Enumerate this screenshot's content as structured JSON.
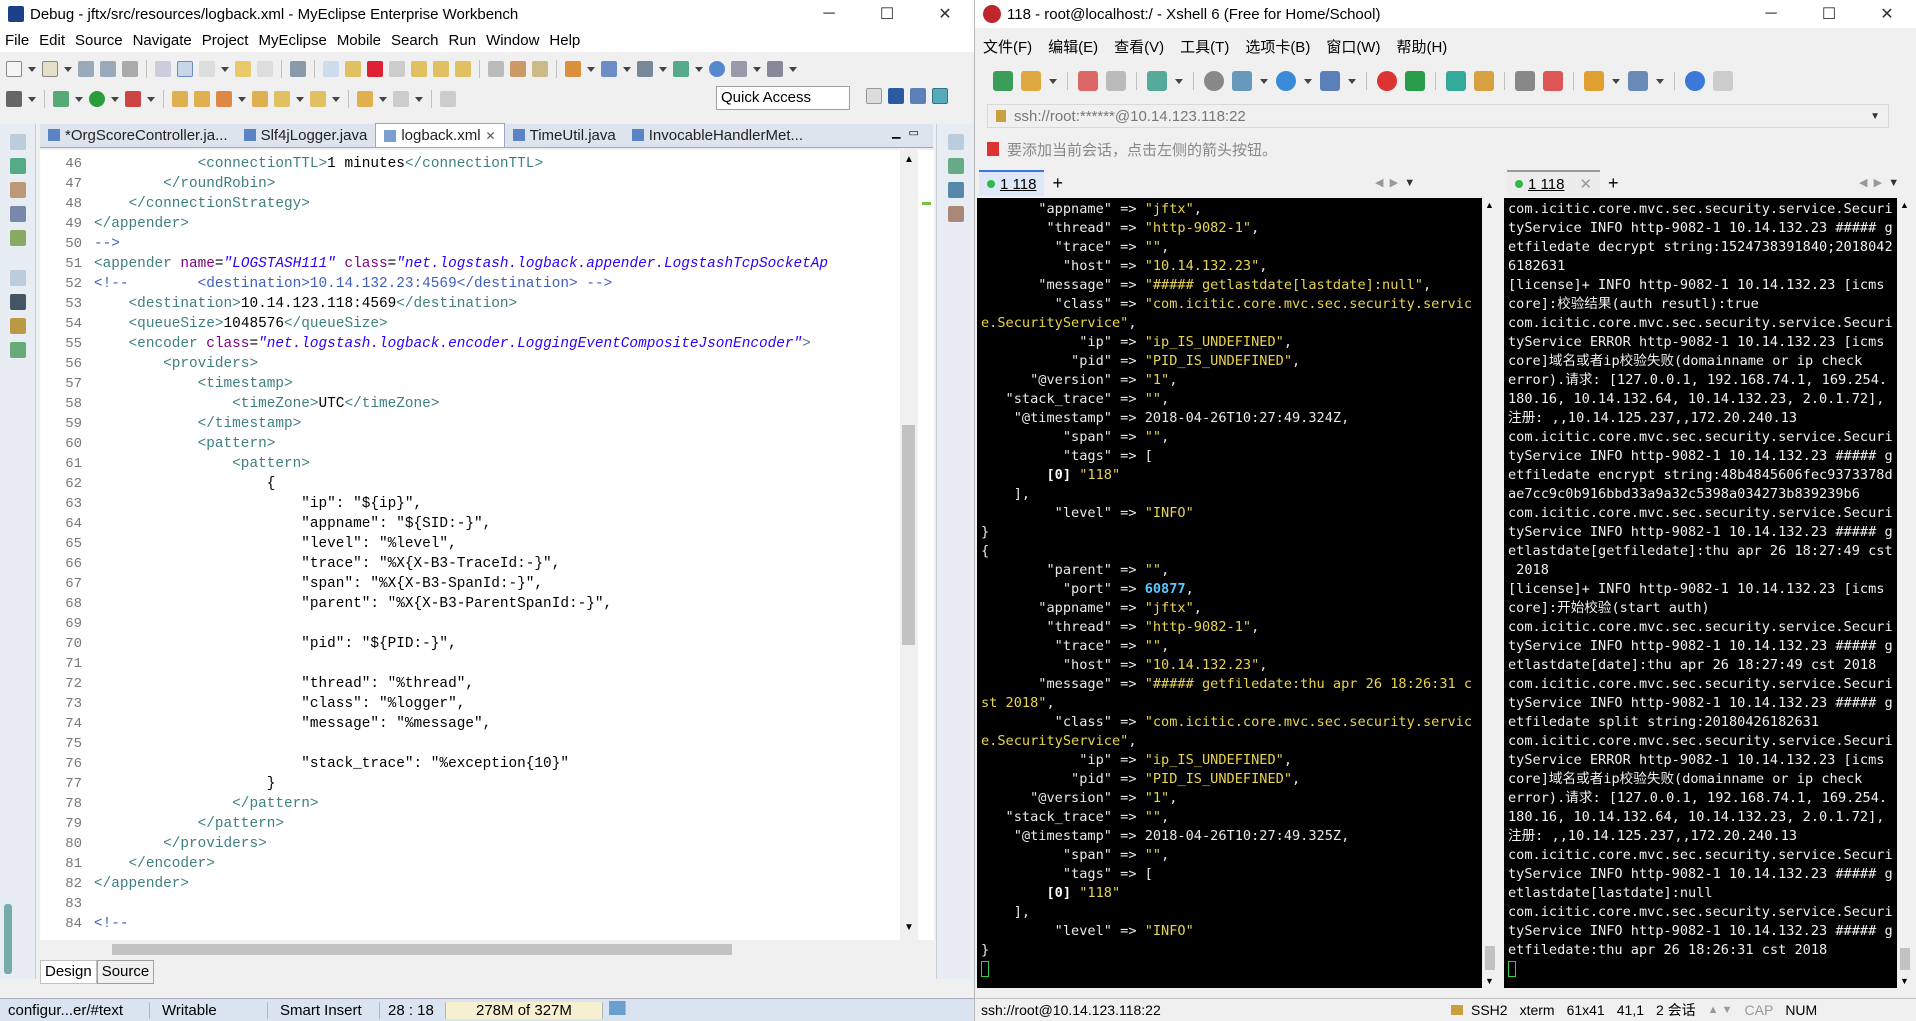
{
  "eclipse": {
    "title": "Debug - jftx/src/resources/logback.xml - MyEclipse Enterprise Workbench",
    "menu": [
      "File",
      "Edit",
      "Source",
      "Navigate",
      "Project",
      "MyEclipse",
      "Mobile",
      "Search",
      "Run",
      "Window",
      "Help"
    ],
    "quick_access_placeholder": "Quick Access",
    "tabs": [
      {
        "label": "*OrgScoreController.ja...",
        "active": false
      },
      {
        "label": "Slf4jLogger.java",
        "active": false
      },
      {
        "label": "logback.xml",
        "active": true
      },
      {
        "label": "TimeUtil.java",
        "active": false
      },
      {
        "label": "InvocableHandlerMet...",
        "active": false
      }
    ],
    "lines": [
      {
        "n": "46",
        "code": [
          [
            "t",
            "            <connectionTTL>"
          ],
          [
            "tx",
            "1 minutes"
          ],
          [
            "t",
            "</connectionTTL>"
          ]
        ]
      },
      {
        "n": "47",
        "code": [
          [
            "t",
            "        </roundRobin>"
          ]
        ]
      },
      {
        "n": "48",
        "code": [
          [
            "t",
            "    </connectionStrategy>"
          ]
        ]
      },
      {
        "n": "49",
        "code": [
          [
            "t",
            "</appender>"
          ]
        ]
      },
      {
        "n": "50",
        "code": [
          [
            "c",
            "-->"
          ]
        ]
      },
      {
        "n": "51",
        "code": [
          [
            "t",
            "<appender "
          ],
          [
            "a",
            "name"
          ],
          [
            "tx",
            "="
          ],
          [
            "v",
            "\"LOGSTASH111\""
          ],
          [
            "tx",
            " "
          ],
          [
            "a",
            "class"
          ],
          [
            "tx",
            "="
          ],
          [
            "v",
            "\"net.logstash.logback.appender.LogstashTcpSocketAp"
          ]
        ]
      },
      {
        "n": "52",
        "code": [
          [
            "c",
            "<!--        <destination>10.14.132.23:4569</destination> -->"
          ]
        ]
      },
      {
        "n": "53",
        "code": [
          [
            "t",
            "    <destination>"
          ],
          [
            "tx",
            "10.14.123.118:4569"
          ],
          [
            "t",
            "</destination>"
          ]
        ]
      },
      {
        "n": "54",
        "code": [
          [
            "t",
            "    <queueSize>"
          ],
          [
            "tx",
            "1048576"
          ],
          [
            "t",
            "</queueSize>"
          ]
        ]
      },
      {
        "n": "55",
        "code": [
          [
            "t",
            "    <encoder "
          ],
          [
            "a",
            "class"
          ],
          [
            "tx",
            "="
          ],
          [
            "v",
            "\"net.logstash.logback.encoder.LoggingEventCompositeJsonEncoder\""
          ],
          [
            "t",
            ">"
          ]
        ]
      },
      {
        "n": "56",
        "code": [
          [
            "t",
            "        <providers>"
          ]
        ]
      },
      {
        "n": "57",
        "code": [
          [
            "t",
            "            <timestamp>"
          ]
        ]
      },
      {
        "n": "58",
        "code": [
          [
            "t",
            "                <timeZone>"
          ],
          [
            "tx",
            "UTC"
          ],
          [
            "t",
            "</timeZone>"
          ]
        ]
      },
      {
        "n": "59",
        "code": [
          [
            "t",
            "            </timestamp>"
          ]
        ]
      },
      {
        "n": "60",
        "code": [
          [
            "t",
            "            <pattern>"
          ]
        ]
      },
      {
        "n": "61",
        "code": [
          [
            "t",
            "                <pattern>"
          ]
        ]
      },
      {
        "n": "62",
        "code": [
          [
            "tx",
            "                    {"
          ]
        ]
      },
      {
        "n": "63",
        "code": [
          [
            "tx",
            "                        \"ip\": \"${ip}\","
          ]
        ]
      },
      {
        "n": "64",
        "code": [
          [
            "tx",
            "                        \"appname\": \"${SID:-}\","
          ]
        ]
      },
      {
        "n": "65",
        "code": [
          [
            "tx",
            "                        \"level\": \"%level\","
          ]
        ]
      },
      {
        "n": "66",
        "code": [
          [
            "tx",
            "                        \"trace\": \"%X{X-B3-TraceId:-}\","
          ]
        ]
      },
      {
        "n": "67",
        "code": [
          [
            "tx",
            "                        \"span\": \"%X{X-B3-SpanId:-}\","
          ]
        ]
      },
      {
        "n": "68",
        "code": [
          [
            "tx",
            "                        \"parent\": \"%X{X-B3-ParentSpanId:-}\","
          ]
        ]
      },
      {
        "n": "69",
        "code": [
          [
            "tx",
            ""
          ]
        ]
      },
      {
        "n": "70",
        "code": [
          [
            "tx",
            "                        \"pid\": \"${PID:-}\","
          ]
        ]
      },
      {
        "n": "71",
        "code": [
          [
            "tx",
            ""
          ]
        ]
      },
      {
        "n": "72",
        "code": [
          [
            "tx",
            "                        \"thread\": \"%thread\","
          ]
        ]
      },
      {
        "n": "73",
        "code": [
          [
            "tx",
            "                        \"class\": \"%logger\","
          ]
        ]
      },
      {
        "n": "74",
        "code": [
          [
            "tx",
            "                        \"message\": \"%message\","
          ]
        ]
      },
      {
        "n": "75",
        "code": [
          [
            "tx",
            ""
          ]
        ]
      },
      {
        "n": "76",
        "code": [
          [
            "tx",
            "                        \"stack_trace\": \"%exception{10}\""
          ]
        ]
      },
      {
        "n": "77",
        "code": [
          [
            "tx",
            "                    }"
          ]
        ]
      },
      {
        "n": "78",
        "code": [
          [
            "t",
            "                </pattern>"
          ]
        ]
      },
      {
        "n": "79",
        "code": [
          [
            "t",
            "            </pattern>"
          ]
        ]
      },
      {
        "n": "80",
        "code": [
          [
            "t",
            "        </providers>"
          ]
        ]
      },
      {
        "n": "81",
        "code": [
          [
            "t",
            "    </encoder>"
          ]
        ]
      },
      {
        "n": "82",
        "code": [
          [
            "t",
            "</appender>"
          ]
        ]
      },
      {
        "n": "83",
        "code": [
          [
            "tx",
            ""
          ]
        ]
      },
      {
        "n": "84",
        "code": [
          [
            "c",
            "<!--"
          ]
        ]
      }
    ],
    "bottom_tabs": [
      "Design",
      "Source"
    ],
    "status": {
      "path": "configur...er/#text",
      "mode": "Writable",
      "insert": "Smart Insert",
      "position": "28 : 18",
      "memory": "278M of 327M"
    }
  },
  "xshell": {
    "title": "118 - root@localhost:/ - Xshell 6 (Free for Home/School)",
    "menu": [
      "文件(F)",
      "编辑(E)",
      "查看(V)",
      "工具(T)",
      "选项卡(B)",
      "窗口(W)",
      "帮助(H)"
    ],
    "address": "ssh://root:******@10.14.123.118:22",
    "hint": "要添加当前会话，点击左侧的箭头按钮。",
    "tab_left": "1 118",
    "tab_right": "1 118",
    "left_terminal": [
      [
        [
          "k",
          "       \"appname\" => "
        ],
        [
          "s",
          "\"jftx\""
        ],
        [
          "k",
          ","
        ]
      ],
      [
        [
          "k",
          "        \"thread\" => "
        ],
        [
          "s",
          "\"http-9082-1\""
        ],
        [
          "k",
          ","
        ]
      ],
      [
        [
          "k",
          "         \"trace\" => "
        ],
        [
          "s",
          "\"\""
        ],
        [
          "k",
          ","
        ]
      ],
      [
        [
          "k",
          "          \"host\" => "
        ],
        [
          "s",
          "\"10.14.132.23\""
        ],
        [
          "k",
          ","
        ]
      ],
      [
        [
          "k",
          "       \"message\" => "
        ],
        [
          "s",
          "\"##### getlastdate[lastdate]:null\""
        ],
        [
          "k",
          ","
        ]
      ],
      [
        [
          "k",
          "         \"class\" => "
        ],
        [
          "s",
          "\"com.icitic.core.mvc.sec.security.servic"
        ]
      ],
      [
        [
          "s",
          "e.SecurityService\""
        ],
        [
          "k",
          ","
        ]
      ],
      [
        [
          "k",
          "            \"ip\" => "
        ],
        [
          "s",
          "\"ip_IS_UNDEFINED\""
        ],
        [
          "k",
          ","
        ]
      ],
      [
        [
          "k",
          "           \"pid\" => "
        ],
        [
          "s",
          "\"PID_IS_UNDEFINED\""
        ],
        [
          "k",
          ","
        ]
      ],
      [
        [
          "k",
          "      \"@version\" => "
        ],
        [
          "s",
          "\"1\""
        ],
        [
          "k",
          ","
        ]
      ],
      [
        [
          "k",
          "   \"stack_trace\" => "
        ],
        [
          "s",
          "\"\""
        ],
        [
          "k",
          ","
        ]
      ],
      [
        [
          "k",
          "    \"@timestamp\" => "
        ],
        [
          "k",
          "2018-04-26T10:27:49.324Z,"
        ]
      ],
      [
        [
          "k",
          "          \"span\" => "
        ],
        [
          "s",
          "\"\""
        ],
        [
          "k",
          ","
        ]
      ],
      [
        [
          "k",
          "          \"tags\" => ["
        ]
      ],
      [
        [
          "w",
          "        [0] "
        ],
        [
          "s",
          "\"118\""
        ]
      ],
      [
        [
          "k",
          "    ],"
        ]
      ],
      [
        [
          "k",
          "         \"level\" => "
        ],
        [
          "s",
          "\"INFO\""
        ]
      ],
      [
        [
          "k",
          "}"
        ]
      ],
      [
        [
          "k",
          "{"
        ]
      ],
      [
        [
          "k",
          "        \"parent\" => "
        ],
        [
          "s",
          "\"\""
        ],
        [
          "k",
          ","
        ]
      ],
      [
        [
          "k",
          "          \"port\" => "
        ],
        [
          "n",
          "60877"
        ],
        [
          "k",
          ","
        ]
      ],
      [
        [
          "k",
          "       \"appname\" => "
        ],
        [
          "s",
          "\"jftx\""
        ],
        [
          "k",
          ","
        ]
      ],
      [
        [
          "k",
          "        \"thread\" => "
        ],
        [
          "s",
          "\"http-9082-1\""
        ],
        [
          "k",
          ","
        ]
      ],
      [
        [
          "k",
          "         \"trace\" => "
        ],
        [
          "s",
          "\"\""
        ],
        [
          "k",
          ","
        ]
      ],
      [
        [
          "k",
          "          \"host\" => "
        ],
        [
          "s",
          "\"10.14.132.23\""
        ],
        [
          "k",
          ","
        ]
      ],
      [
        [
          "k",
          "       \"message\" => "
        ],
        [
          "s",
          "\"##### getfiledate:thu apr 26 18:26:31 c"
        ]
      ],
      [
        [
          "s",
          "st 2018\""
        ],
        [
          "k",
          ","
        ]
      ],
      [
        [
          "k",
          "         \"class\" => "
        ],
        [
          "s",
          "\"com.icitic.core.mvc.sec.security.servic"
        ]
      ],
      [
        [
          "s",
          "e.SecurityService\""
        ],
        [
          "k",
          ","
        ]
      ],
      [
        [
          "k",
          "            \"ip\" => "
        ],
        [
          "s",
          "\"ip_IS_UNDEFINED\""
        ],
        [
          "k",
          ","
        ]
      ],
      [
        [
          "k",
          "           \"pid\" => "
        ],
        [
          "s",
          "\"PID_IS_UNDEFINED\""
        ],
        [
          "k",
          ","
        ]
      ],
      [
        [
          "k",
          "      \"@version\" => "
        ],
        [
          "s",
          "\"1\""
        ],
        [
          "k",
          ","
        ]
      ],
      [
        [
          "k",
          "   \"stack_trace\" => "
        ],
        [
          "s",
          "\"\""
        ],
        [
          "k",
          ","
        ]
      ],
      [
        [
          "k",
          "    \"@timestamp\" => "
        ],
        [
          "k",
          "2018-04-26T10:27:49.325Z,"
        ]
      ],
      [
        [
          "k",
          "          \"span\" => "
        ],
        [
          "s",
          "\"\""
        ],
        [
          "k",
          ","
        ]
      ],
      [
        [
          "k",
          "          \"tags\" => ["
        ]
      ],
      [
        [
          "w",
          "        [0] "
        ],
        [
          "s",
          "\"118\""
        ]
      ],
      [
        [
          "k",
          "    ],"
        ]
      ],
      [
        [
          "k",
          "         \"level\" => "
        ],
        [
          "s",
          "\"INFO\""
        ]
      ],
      [
        [
          "k",
          "}"
        ]
      ]
    ],
    "right_terminal": [
      "com.icitic.core.mvc.sec.security.service.Securi",
      "tyService INFO http-9082-1 10.14.132.23 ##### g",
      "etfiledate decrypt string:1524738391840;2018042",
      "6182631",
      "[license]+ INFO http-9082-1 10.14.132.23 [icms",
      "core]:校验结果(auth resutl):true",
      "com.icitic.core.mvc.sec.security.service.Securi",
      "tyService ERROR http-9082-1 10.14.132.23 [icms",
      "core]域名或者ip校验失败(domainname or ip check",
      "error).请求: [127.0.0.1, 192.168.74.1, 169.254.",
      "180.16, 10.14.132.64, 10.14.132.23, 2.0.1.72],",
      "注册: ,,10.14.125.237,,172.20.240.13",
      "com.icitic.core.mvc.sec.security.service.Securi",
      "tyService INFO http-9082-1 10.14.132.23 ##### g",
      "etfiledate encrypt string:48b4845606fec9373378d",
      "ae7cc9c0b916bbd33a9a32c5398a034273b839239b6",
      "com.icitic.core.mvc.sec.security.service.Securi",
      "tyService INFO http-9082-1 10.14.132.23 ##### g",
      "etlastdate[getfiledate]:thu apr 26 18:27:49 cst",
      " 2018",
      "[license]+ INFO http-9082-1 10.14.132.23 [icms",
      "core]:开始校验(start auth)",
      "com.icitic.core.mvc.sec.security.service.Securi",
      "tyService INFO http-9082-1 10.14.132.23 ##### g",
      "etlastdate[date]:thu apr 26 18:27:49 cst 2018",
      "com.icitic.core.mvc.sec.security.service.Securi",
      "tyService INFO http-9082-1 10.14.132.23 ##### g",
      "etfiledate split string:20180426182631",
      "com.icitic.core.mvc.sec.security.service.Securi",
      "tyService ERROR http-9082-1 10.14.132.23 [icms",
      "core]域名或者ip校验失败(domainname or ip check",
      "error).请求: [127.0.0.1, 192.168.74.1, 169.254.",
      "180.16, 10.14.132.64, 10.14.132.23, 2.0.1.72],",
      "注册: ,,10.14.125.237,,172.20.240.13",
      "com.icitic.core.mvc.sec.security.service.Securi",
      "tyService INFO http-9082-1 10.14.132.23 ##### g",
      "etlastdate[lastdate]:null",
      "com.icitic.core.mvc.sec.security.service.Securi",
      "tyService INFO http-9082-1 10.14.132.23 ##### g",
      "etfiledate:thu apr 26 18:26:31 cst 2018"
    ],
    "status": {
      "connection": "ssh://root@10.14.123.118:22",
      "protocol": "SSH2",
      "term": "xterm",
      "size": "61x41",
      "cursor": "41,1",
      "sessions": "2 会话",
      "caps": "CAP",
      "num": "NUM"
    }
  }
}
